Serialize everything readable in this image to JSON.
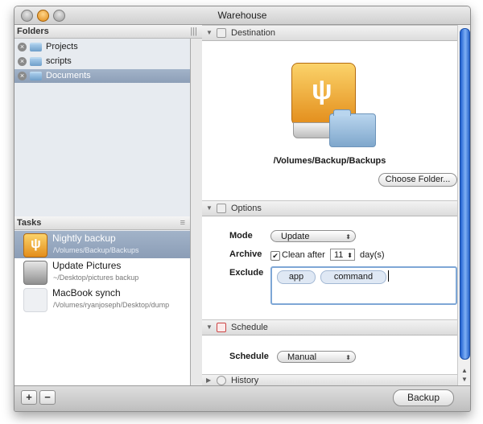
{
  "window": {
    "title": "Warehouse"
  },
  "folders": {
    "header": "Folders",
    "items": [
      {
        "label": "Projects"
      },
      {
        "label": "scripts"
      },
      {
        "label": "Documents"
      }
    ]
  },
  "tasks": {
    "header": "Tasks",
    "items": [
      {
        "title": "Nightly backup",
        "subtitle": "/Volumes/Backup/Backups"
      },
      {
        "title": "Update Pictures",
        "subtitle": "~/Desktop/pictures backup"
      },
      {
        "title": "MacBook synch",
        "subtitle": "/Volumes/ryanjoseph/Desktop/dump"
      }
    ]
  },
  "destination": {
    "header": "Destination",
    "path": "/Volumes/Backup/Backups",
    "choose_button": "Choose Folder..."
  },
  "options": {
    "header": "Options",
    "mode_label": "Mode",
    "mode_value": "Update",
    "archive_label": "Archive",
    "clean_after_label": "Clean after",
    "clean_after_checked": true,
    "days_value": "11",
    "days_unit": "day(s)",
    "exclude_label": "Exclude",
    "exclude_tokens": [
      "app",
      "command"
    ]
  },
  "schedule": {
    "header": "Schedule",
    "label": "Schedule",
    "value": "Manual"
  },
  "history": {
    "header": "History"
  },
  "bottom": {
    "add": "+",
    "remove": "−",
    "backup_button": "Backup"
  }
}
